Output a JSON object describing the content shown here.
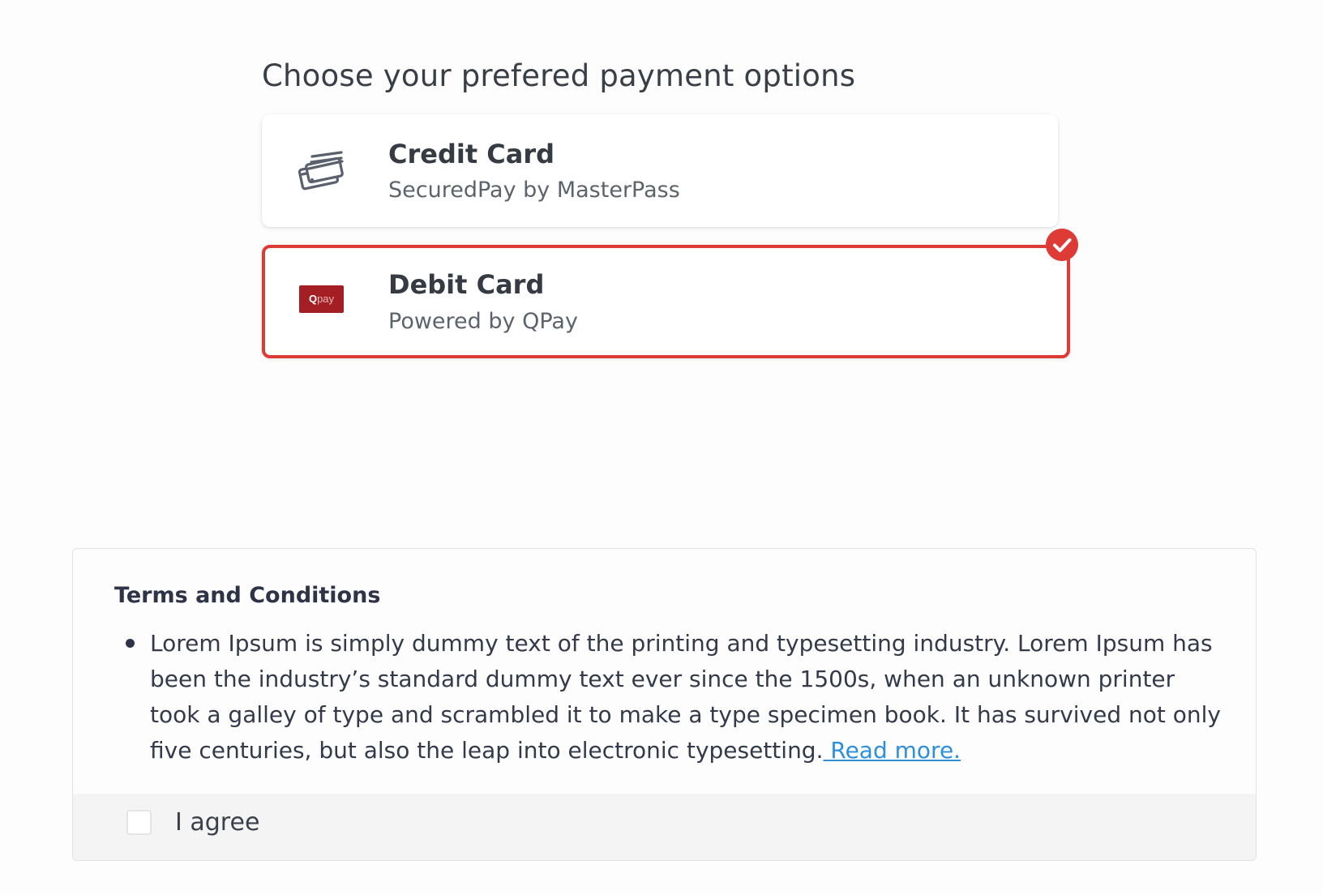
{
  "payment": {
    "heading": "Choose your prefered payment options",
    "options": [
      {
        "title": "Credit Card",
        "subtitle": "SecuredPay by MasterPass",
        "icon": "credit-cards-icon",
        "selected": false
      },
      {
        "title": "Debit Card",
        "subtitle": "Powered by QPay",
        "icon": "qpay-logo",
        "logo_text_q": "Q",
        "logo_text_pay": "pay",
        "selected": true
      }
    ],
    "selected_color": "#de3a36"
  },
  "terms": {
    "title": "Terms and Conditions",
    "body": "Lorem Ipsum is simply dummy text of the printing and typesetting industry. Lorem Ipsum has been the industry’s standard dummy text ever since the 1500s, when an unknown printer took a galley of type and scrambled it to make a type specimen book. It has survived not only five centuries, but also the leap into electronic typesetting.",
    "read_more": " Read more.",
    "agree_label": "I agree",
    "agree_checked": false,
    "link_color": "#2e8fdc"
  }
}
